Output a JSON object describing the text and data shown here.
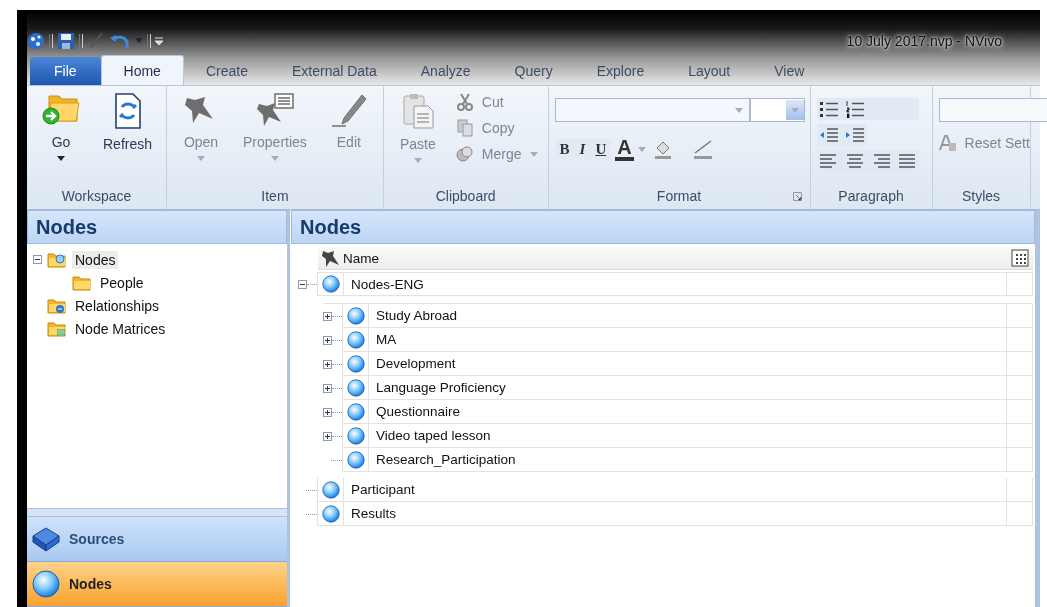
{
  "window": {
    "title": "10 July 2017.nvp - NVivo"
  },
  "ribbon_tabs": [
    {
      "label": "File",
      "kind": "file",
      "selected": false
    },
    {
      "label": "Home",
      "kind": "tab",
      "selected": true
    },
    {
      "label": "Create",
      "kind": "tab",
      "selected": false
    },
    {
      "label": "External Data",
      "kind": "tab",
      "selected": false
    },
    {
      "label": "Analyze",
      "kind": "tab",
      "selected": false
    },
    {
      "label": "Query",
      "kind": "tab",
      "selected": false
    },
    {
      "label": "Explore",
      "kind": "tab",
      "selected": false
    },
    {
      "label": "Layout",
      "kind": "tab",
      "selected": false
    },
    {
      "label": "View",
      "kind": "tab",
      "selected": false
    }
  ],
  "ribbon_groups": [
    {
      "label": "Workspace",
      "kind": "commands",
      "commands": [
        {
          "label": "Go",
          "kind": "large",
          "dropdown": true,
          "disabled": false
        },
        {
          "label": "Refresh",
          "kind": "large",
          "dropdown": false,
          "disabled": false
        }
      ]
    },
    {
      "label": "Item",
      "kind": "commands",
      "commands": [
        {
          "label": "Open",
          "kind": "large",
          "dropdown": true,
          "disabled": true
        },
        {
          "label": "Properties",
          "kind": "large",
          "dropdown": true,
          "disabled": true
        },
        {
          "label": "Edit",
          "kind": "large",
          "dropdown": false,
          "disabled": true
        }
      ]
    },
    {
      "label": "Clipboard",
      "kind": "commands",
      "commands": [
        {
          "label": "Paste",
          "kind": "large",
          "dropdown": true,
          "disabled": true
        },
        {
          "label": "Cut",
          "kind": "small",
          "dropdown": false,
          "disabled": true
        },
        {
          "label": "Copy",
          "kind": "small",
          "dropdown": false,
          "disabled": true
        },
        {
          "label": "Merge",
          "kind": "small",
          "dropdown": true,
          "disabled": true
        }
      ]
    },
    {
      "label": "Format",
      "kind": "format",
      "launcher": true,
      "buttons": [
        {
          "label": "B",
          "kind": "bold"
        },
        {
          "label": "I",
          "kind": "italic"
        },
        {
          "label": "U",
          "kind": "underline"
        },
        {
          "label": "A",
          "kind": "font-color"
        }
      ]
    },
    {
      "label": "Paragraph",
      "kind": "paragraph"
    },
    {
      "label": "Styles",
      "kind": "styles",
      "commands": [
        {
          "label": "Reset Sett",
          "disabled": true
        }
      ]
    }
  ],
  "navigation": {
    "title": "Nodes",
    "tree": [
      {
        "label": "Nodes",
        "kind": "folder-open",
        "selected": true,
        "expanded": true,
        "children": [
          {
            "label": "People",
            "kind": "folder",
            "selected": false
          }
        ]
      },
      {
        "label": "Relationships",
        "kind": "relationships",
        "selected": false
      },
      {
        "label": "Node Matrices",
        "kind": "matrices",
        "selected": false
      }
    ],
    "buttons": [
      {
        "label": "Sources",
        "kind": "sources",
        "selected": false
      },
      {
        "label": "Nodes",
        "kind": "nodes",
        "selected": true
      }
    ]
  },
  "list": {
    "title": "Nodes",
    "columns": [
      {
        "label": "Name"
      }
    ],
    "rows": [
      {
        "name": "Nodes-ENG",
        "expanded": true,
        "children": [
          {
            "name": "Study Abroad",
            "expanded": false
          },
          {
            "name": "MA",
            "expanded": false
          },
          {
            "name": "Development",
            "expanded": false
          },
          {
            "name": "Language Proficiency",
            "expanded": false
          },
          {
            "name": "Questionnaire",
            "expanded": false
          },
          {
            "name": "Video taped lesson",
            "expanded": false
          },
          {
            "name": "Research_Participation"
          }
        ]
      },
      {
        "name": "Participant"
      },
      {
        "name": "Results"
      }
    ]
  }
}
